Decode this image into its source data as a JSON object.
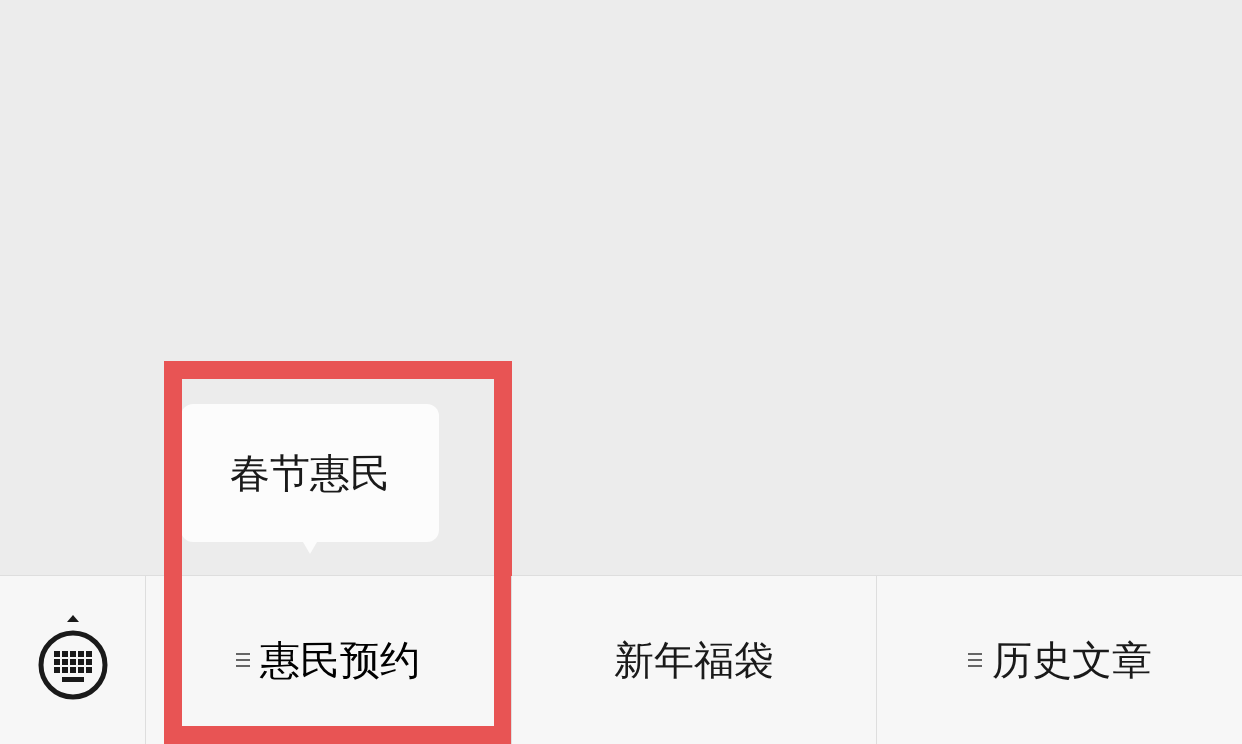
{
  "menu_bar": {
    "items": [
      {
        "label": "惠民预约",
        "has_submenu": true,
        "expanded": true,
        "highlighted": true,
        "submenu": [
          "春节惠民"
        ]
      },
      {
        "label": "新年福袋",
        "has_submenu": false,
        "expanded": false,
        "highlighted": false
      },
      {
        "label": "历史文章",
        "has_submenu": true,
        "expanded": false,
        "highlighted": false
      }
    ]
  },
  "highlight": {
    "color": "#e85454"
  }
}
